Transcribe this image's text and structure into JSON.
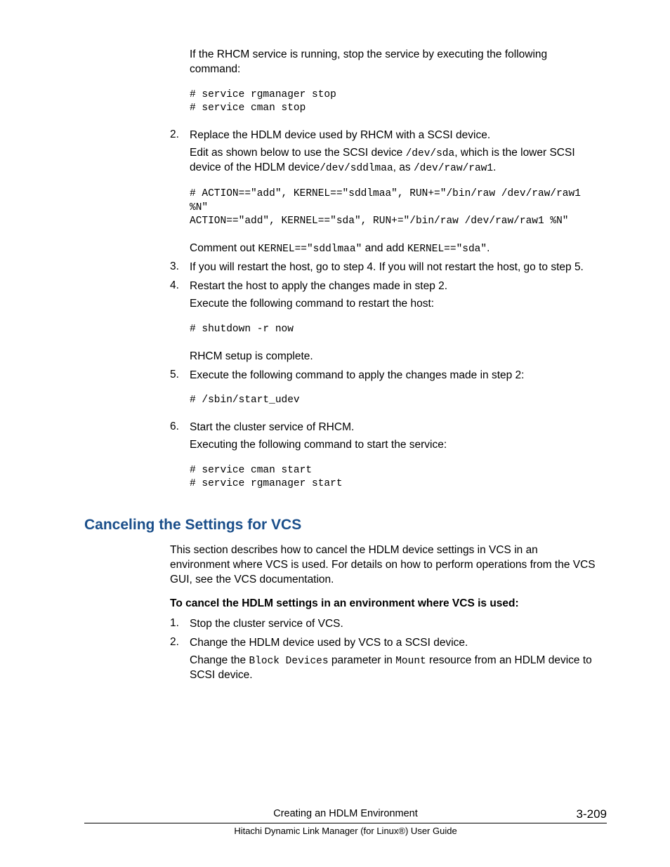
{
  "top": {
    "intro": "If the RHCM service is running, stop the service by executing the following command:",
    "code": "# service rgmanager stop\n# service cman stop"
  },
  "steps_a": [
    {
      "num": "2.",
      "p1_prefix": "Replace the HDLM device used by RHCM with a SCSI device.",
      "p2_a": "Edit as shown below to use the SCSI device ",
      "p2_code1": "/dev/sda",
      "p2_b": ", which is the lower SCSI device of the HDLM device",
      "p2_code2": "/dev/sddlmaa",
      "p2_c": ", as ",
      "p2_code3": "/dev/raw/raw1",
      "p2_d": ".",
      "code_block": "# ACTION==\"add\", KERNEL==\"sddlmaa\", RUN+=\"/bin/raw /dev/raw/raw1 %N\"\nACTION==\"add\", KERNEL==\"sda\", RUN+=\"/bin/raw /dev/raw/raw1 %N\"",
      "p3_a": "Comment out ",
      "p3_code1": "KERNEL==\"sddlmaa\"",
      "p3_b": " and add ",
      "p3_code2": "KERNEL==\"sda\"",
      "p3_c": "."
    },
    {
      "num": "3.",
      "p1": "If you will restart the host, go to step 4. If you will not restart the host, go to step 5."
    },
    {
      "num": "4.",
      "p1": "Restart the host to apply the changes made in step 2.",
      "p2": "Execute the following command to restart the host:",
      "code_block": "# shutdown -r now",
      "p3": "RHCM setup is complete."
    },
    {
      "num": "5.",
      "p1": "Execute the following command to apply the changes made in step 2:",
      "code_block": "# /sbin/start_udev"
    },
    {
      "num": "6.",
      "p1": "Start the cluster service of RHCM.",
      "p2": "Executing the following command to start the service:",
      "code_block": "# service cman start\n# service rgmanager start"
    }
  ],
  "section": {
    "heading": "Canceling the Settings for VCS",
    "intro": "This section describes how to cancel the HDLM device settings in VCS in an environment where VCS is used. For details on how to perform operations from the VCS GUI, see the VCS documentation.",
    "subheading": "To cancel the HDLM settings in an environment where VCS is used:"
  },
  "steps_b": [
    {
      "num": "1.",
      "p1": "Stop the cluster service of VCS."
    },
    {
      "num": "2.",
      "p1": "Change the HDLM device used by VCS to a SCSI device.",
      "p2_a": "Change the ",
      "p2_code1": "Block Devices",
      "p2_b": " parameter in ",
      "p2_code2": "Mount",
      "p2_c": " resource from an HDLM device to SCSI device."
    }
  ],
  "footer": {
    "center1": "Creating an HDLM Environment",
    "right": "3-209",
    "center2": "Hitachi Dynamic Link Manager (for Linux®) User Guide"
  }
}
